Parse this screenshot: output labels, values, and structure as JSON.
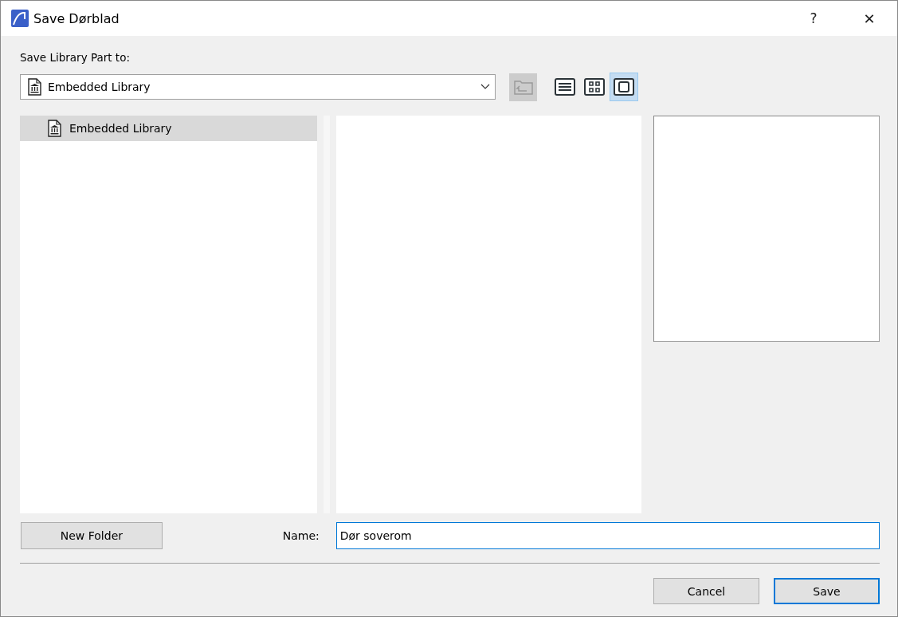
{
  "window": {
    "title": "Save Dørblad",
    "help": "?",
    "close": "✕"
  },
  "save_to": {
    "label": "Save Library Part to:",
    "value": "Embedded Library"
  },
  "toolbar": {
    "up_folder": {
      "disabled": true
    },
    "views": [
      {
        "kind": "list",
        "selected": false
      },
      {
        "kind": "icons",
        "selected": false
      },
      {
        "kind": "preview",
        "selected": true
      }
    ]
  },
  "tree": {
    "items": [
      {
        "label": "Embedded Library",
        "selected": true
      }
    ]
  },
  "new_folder": "New Folder",
  "name": {
    "label": "Name:",
    "value": "Dør soverom"
  },
  "buttons": [
    {
      "label": "Cancel",
      "default": false
    },
    {
      "label": "Save",
      "default": true
    }
  ]
}
